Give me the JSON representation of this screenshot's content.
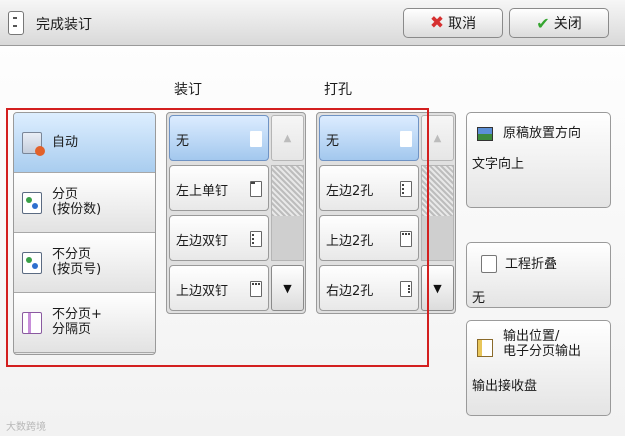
{
  "window": {
    "title": "完成装订"
  },
  "toolbar": {
    "cancel_label": "取消",
    "close_label": "关闭"
  },
  "columns": {
    "staple_header": "装订",
    "punch_header": "打孔"
  },
  "modes": [
    {
      "label": "自动",
      "selected": true
    },
    {
      "label": "分页\n(按份数)",
      "selected": false
    },
    {
      "label": "不分页\n(按页号)",
      "selected": false
    },
    {
      "label": "不分页+\n分隔页",
      "selected": false
    }
  ],
  "staple": {
    "items": [
      {
        "label": "无",
        "selected": true
      },
      {
        "label": "左上单钉",
        "selected": false
      },
      {
        "label": "左边双钉",
        "selected": false
      },
      {
        "label": "上边双钉",
        "selected": false
      }
    ]
  },
  "punch": {
    "items": [
      {
        "label": "无",
        "selected": true
      },
      {
        "label": "左边2孔",
        "selected": false
      },
      {
        "label": "上边2孔",
        "selected": false
      },
      {
        "label": "右边2孔",
        "selected": false
      }
    ]
  },
  "orientation": {
    "title": "原稿放置方向",
    "value": "文字向上"
  },
  "folding": {
    "title": "工程折叠",
    "value": "无"
  },
  "output": {
    "title": "输出位置/\n电子分页输出",
    "value": "输出接收盘"
  },
  "watermark": "大数跨境",
  "colors": {
    "selected": "#a9cdef",
    "frame": "#d31f1f"
  }
}
